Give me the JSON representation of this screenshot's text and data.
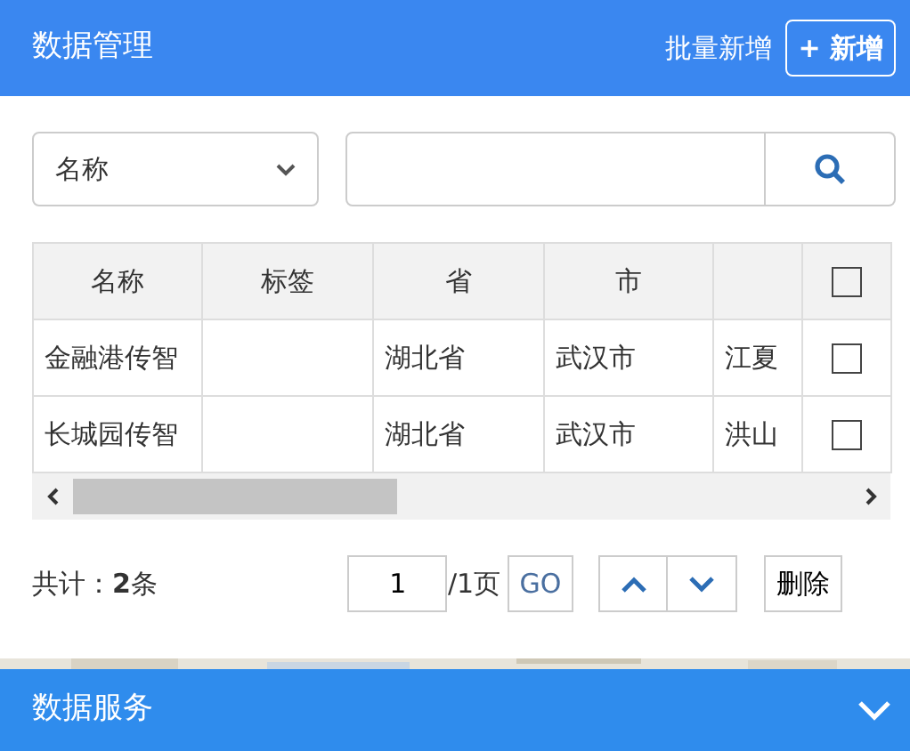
{
  "panel": {
    "title": "数据管理",
    "batch_add": "批量新增",
    "add_button": "+ 新增"
  },
  "search": {
    "field_selector": "名称"
  },
  "table": {
    "columns": [
      "名称",
      "标签",
      "省",
      "市"
    ],
    "header_checked": false,
    "rows": [
      {
        "cells": [
          "金融港传智",
          "",
          "湖北省",
          "武汉市",
          "江夏"
        ],
        "checked": false
      },
      {
        "cells": [
          "长城园传智",
          "",
          "湖北省",
          "武汉市",
          "洪山"
        ],
        "checked": false
      }
    ]
  },
  "footer": {
    "total": "共计：**2**条",
    "page": "1",
    "pages": "/1页",
    "go": "GO",
    "delete": "删除"
  },
  "section": {
    "title": "数据服务",
    "expanded": false
  }
}
